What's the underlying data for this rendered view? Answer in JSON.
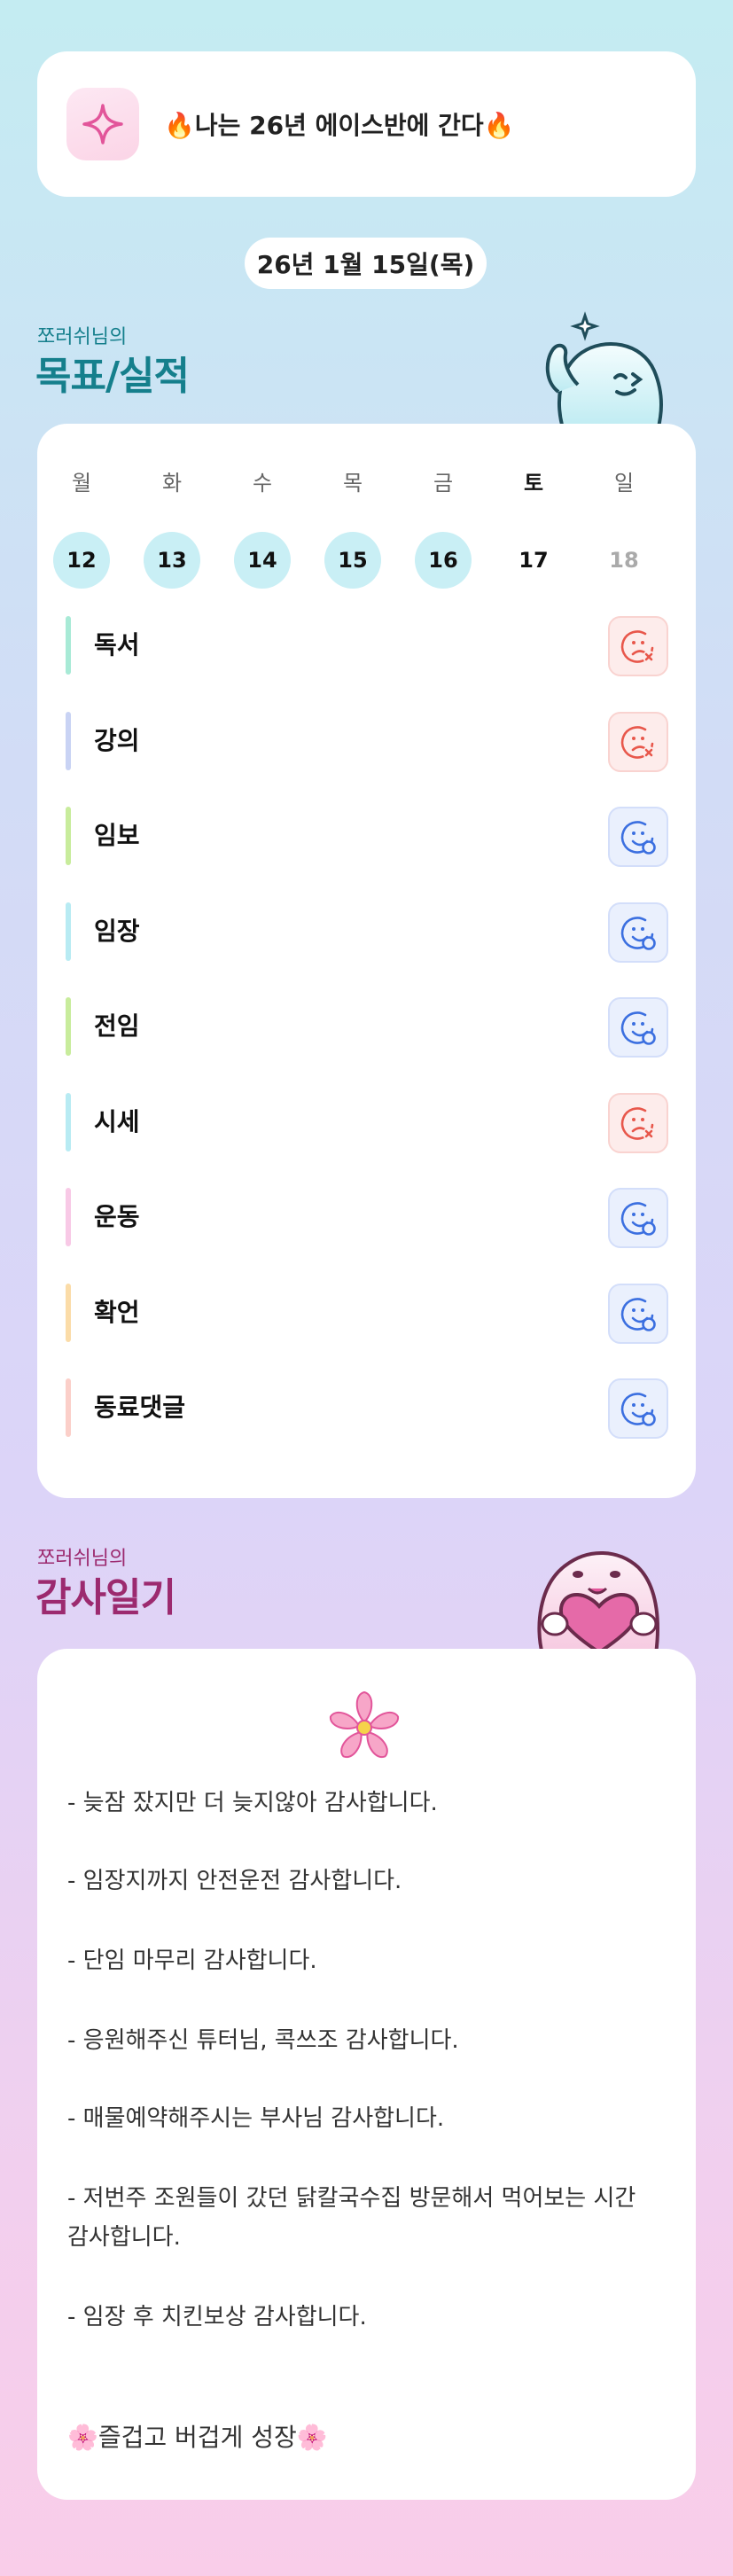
{
  "goal": {
    "text": "🔥나는 26년 에이스반에 간다🔥",
    "icon": "sparkle-icon"
  },
  "date": "26년 1월 15일(목)",
  "goals_section": {
    "subtitle": "쪼러쉬님의",
    "title": "목표/실적"
  },
  "week": {
    "days": [
      {
        "name": "월",
        "num": "12"
      },
      {
        "name": "화",
        "num": "13"
      },
      {
        "name": "수",
        "num": "14"
      },
      {
        "name": "목",
        "num": "15"
      },
      {
        "name": "금",
        "num": "16"
      },
      {
        "name": "토",
        "num": "17"
      },
      {
        "name": "일",
        "num": "18"
      }
    ]
  },
  "tasks": [
    {
      "label": "독서",
      "status": "fail",
      "color": "#a8ead6"
    },
    {
      "label": "강의",
      "status": "fail",
      "color": "#c9d3f4"
    },
    {
      "label": "임보",
      "status": "done",
      "color": "#c8ec9c"
    },
    {
      "label": "임장",
      "status": "done",
      "color": "#b8ebf3"
    },
    {
      "label": "전임",
      "status": "done",
      "color": "#c8ec9c"
    },
    {
      "label": "시세",
      "status": "fail",
      "color": "#b8ebf3"
    },
    {
      "label": "운동",
      "status": "done",
      "color": "#f8c9e6"
    },
    {
      "label": "확언",
      "status": "done",
      "color": "#fbdca8"
    },
    {
      "label": "동료댓글",
      "status": "done",
      "color": "#fbcfc9"
    }
  ],
  "colors": {
    "fail": "#e8574b",
    "done": "#3b6fe0",
    "goals_title": "#157f8c",
    "thanks_title": "#9c2a6f"
  },
  "thanks_section": {
    "subtitle": "쪼러쉬님의",
    "title": "감사일기"
  },
  "thanks": {
    "lines": [
      "- 늦잠 잤지만 더 늦지않아 감사합니다.",
      "- 임장지까지 안전운전 감사합니다.",
      "- 단임 마무리 감사합니다.",
      "- 응원해주신 튜터님, 콕쓰조 감사합니다.",
      "- 매물예약해주시는 부사님 감사합니다.",
      "- 저번주 조원들이 갔던 닭칼국수집 방문해서 먹어보는 시간 감사합니다.",
      "- 임장 후 치킨보상 감사합니다."
    ],
    "closing": "🌸즐겁고 버겁게 성장🌸"
  }
}
